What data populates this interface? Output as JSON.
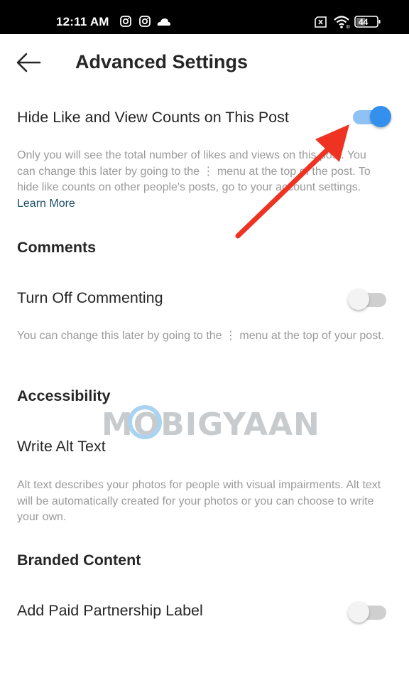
{
  "status_bar": {
    "time": "12:11 AM",
    "left_icons": [
      "instagram-icon",
      "instagram-icon",
      "cloud-icon"
    ],
    "right_icons": [
      "no-sim-icon",
      "wifi-icon",
      "battery-icon"
    ],
    "battery_level": "44"
  },
  "header": {
    "back_icon": "arrow-left-icon",
    "title": "Advanced Settings"
  },
  "settings": {
    "hide_counts": {
      "label": "Hide Like and View Counts on This Post",
      "enabled": true,
      "description": "Only you will see the total number of likes and views on this post. You can change this later by going to the ⋮ menu at the top of the post. To hide like counts on other people's posts, go to your account settings.",
      "link": "Learn More"
    },
    "comments": {
      "section_title": "Comments",
      "turn_off_commenting": {
        "label": "Turn Off Commenting",
        "enabled": false,
        "description": "You can change this later by going to the ⋮ menu at the top of your post."
      }
    },
    "accessibility": {
      "section_title": "Accessibility",
      "alt_text": {
        "label": "Write Alt Text",
        "description": "Alt text describes your photos for people with visual impairments. Alt text will be automatically created for your photos or you can choose to write your own."
      }
    },
    "branded_content": {
      "section_title": "Branded Content",
      "paid_partnership": {
        "label": "Add Paid Partnership Label",
        "enabled": false
      }
    }
  },
  "overlay": {
    "watermark": "MOBIGYAAN",
    "annotation_arrow_color": "#ee3322"
  },
  "colors": {
    "toggle_on_knob": "#3390ec",
    "toggle_on_track": "#8ec1f4",
    "toggle_off_track": "#cfcfcf",
    "link": "#1f4f6a"
  }
}
